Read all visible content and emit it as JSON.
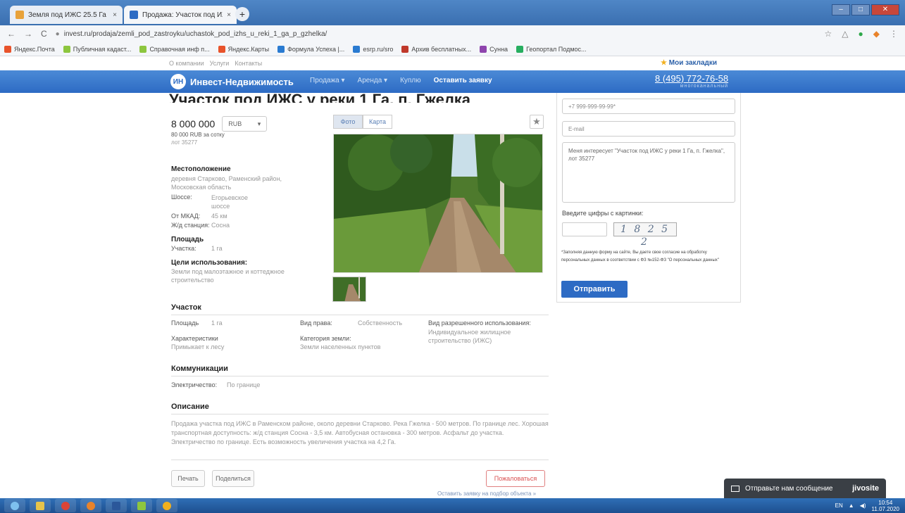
{
  "browser": {
    "tabs": [
      {
        "label": "Земля под ИЖС 25.5 Га | Прода",
        "close": "×"
      },
      {
        "label": "Продажа: Участок под ИЖС у р",
        "close": "×"
      }
    ],
    "new_tab": "+",
    "url": "invest.ru/prodaja/zemli_pod_zastroyku/uchastok_pod_izhs_u_reki_1_ga_p_gzhelka/",
    "bookmarks": [
      {
        "label": "Яндекс.Почта",
        "color": "#e8532b"
      },
      {
        "label": "Публичная кадаст...",
        "color": "#8dc63f"
      },
      {
        "label": "Справочная инф п...",
        "color": "#8dc63f"
      },
      {
        "label": "Яндекс.Карты",
        "color": "#e8532b"
      },
      {
        "label": "Формула Успеха |...",
        "color": "#2a7bd1"
      },
      {
        "label": "esrp.ru/sro",
        "color": "#2a7bd1"
      },
      {
        "label": "Архив бесплатных...",
        "color": "#c0392b"
      },
      {
        "label": "Сунна",
        "color": "#8e44ad"
      },
      {
        "label": "Геопортал Подмос...",
        "color": "#27ae60"
      }
    ]
  },
  "site": {
    "top_links": [
      "О компании",
      "Услуги",
      "Контакты"
    ],
    "favorites": "Мои закладки",
    "logo_mark": "ИН",
    "logo_text": "Инвест-Недвижимость",
    "nav": [
      "Продажа ▾",
      "Аренда ▾",
      "Куплю",
      "Оставить заявку"
    ],
    "phone": "8 (495) 772-76-58",
    "phone_sub": "многоканальный",
    "headline": "Участок под ИЖС у реки 1 Га, п. Гжелка"
  },
  "listing": {
    "price": "8 000 000",
    "currency": "RUB",
    "price_per": "80 000 RUB за сотку",
    "lot": "лот 35277",
    "location_title": "Местоположение",
    "location_text": "деревня Старково, Раменский район, Московская область",
    "highway_label": "Шоссе:",
    "highway_value": "Егорьевское шоссе",
    "mkad_label": "От МКАД:",
    "mkad_value": "45 км",
    "station_label": "Ж/д станция:",
    "station_value": "Соснa",
    "area_title": "Площадь",
    "plot_label": "Участка:",
    "plot_value": "1 га",
    "purpose_title": "Цели использования:",
    "purpose_text": "Земли под малоэтажное и коттеджное строительство",
    "photo_tab": "Фото",
    "map_tab": "Карта",
    "star": "★"
  },
  "form": {
    "phone_placeholder": "+7 999-999-99-99*",
    "email_placeholder": "E-mail",
    "message": "Меня интересует \"Участок под ИЖС у реки 1 Га, п. Гжелка\", лот 35277",
    "captcha_label": "Введите цифры с картинки:",
    "captcha_text": "1 8 2 5 2",
    "consent": "*Заполняя данную форму на сайте, Вы даете свое согласие на обработку персональных данных в соответствии с ФЗ №152-ФЗ \"О персональных данных\"",
    "submit": "Отправить"
  },
  "plot": {
    "title": "Участок",
    "area_label": "Площадь",
    "area_value": "1 га",
    "char_label": "Характеристики",
    "char_value": "Примыкает к лесу",
    "right_label": "Вид права:",
    "right_value": "Собственность",
    "category_label": "Категория земли:",
    "category_value": "Земли населенных пунктов",
    "use_label": "Вид разрешенного использования:",
    "use_value": "Индивидуальное жилищное строительство (ИЖС)"
  },
  "comms": {
    "title": "Коммуникации",
    "elec_label": "Электричество:",
    "elec_value": "По границе"
  },
  "description": {
    "title": "Описание",
    "text": "Продажа участка под ИЖС в Раменском районе, около деревни Старково. Река Гжелка - 500 метров. По границе лес. Хорошая транспортная доступность: ж/д станция Сосна - 3,5 км. Автобусная остановка - 300 метров. Асфальт до участка. Электричество по границе. Есть возможность увеличения участка на 4,2 Га."
  },
  "actions": {
    "print": "Печать",
    "share": "Поделиться",
    "complain": "Пожаловаться",
    "order_link": "Оставить заявку на подбор объекта »"
  },
  "chat": {
    "label": "Отправьте нам сообщение",
    "brand": "jivosite"
  },
  "taskbar": {
    "lang": "EN",
    "time": "10:54",
    "date": "11.07.2020"
  }
}
